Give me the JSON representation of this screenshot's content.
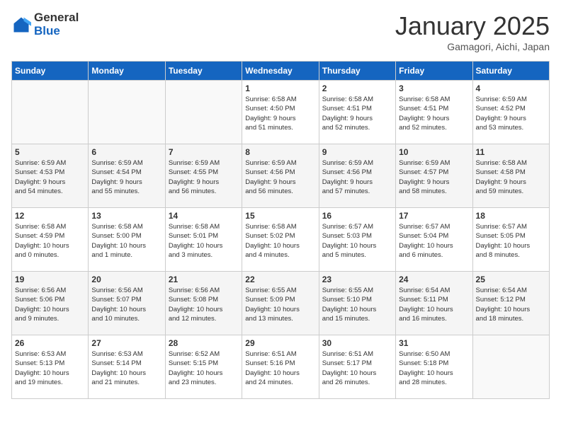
{
  "logo": {
    "general": "General",
    "blue": "Blue"
  },
  "title": "January 2025",
  "subtitle": "Gamagori, Aichi, Japan",
  "days_header": [
    "Sunday",
    "Monday",
    "Tuesday",
    "Wednesday",
    "Thursday",
    "Friday",
    "Saturday"
  ],
  "weeks": [
    [
      {
        "num": "",
        "info": ""
      },
      {
        "num": "",
        "info": ""
      },
      {
        "num": "",
        "info": ""
      },
      {
        "num": "1",
        "info": "Sunrise: 6:58 AM\nSunset: 4:50 PM\nDaylight: 9 hours\nand 51 minutes."
      },
      {
        "num": "2",
        "info": "Sunrise: 6:58 AM\nSunset: 4:51 PM\nDaylight: 9 hours\nand 52 minutes."
      },
      {
        "num": "3",
        "info": "Sunrise: 6:58 AM\nSunset: 4:51 PM\nDaylight: 9 hours\nand 52 minutes."
      },
      {
        "num": "4",
        "info": "Sunrise: 6:59 AM\nSunset: 4:52 PM\nDaylight: 9 hours\nand 53 minutes."
      }
    ],
    [
      {
        "num": "5",
        "info": "Sunrise: 6:59 AM\nSunset: 4:53 PM\nDaylight: 9 hours\nand 54 minutes."
      },
      {
        "num": "6",
        "info": "Sunrise: 6:59 AM\nSunset: 4:54 PM\nDaylight: 9 hours\nand 55 minutes."
      },
      {
        "num": "7",
        "info": "Sunrise: 6:59 AM\nSunset: 4:55 PM\nDaylight: 9 hours\nand 56 minutes."
      },
      {
        "num": "8",
        "info": "Sunrise: 6:59 AM\nSunset: 4:56 PM\nDaylight: 9 hours\nand 56 minutes."
      },
      {
        "num": "9",
        "info": "Sunrise: 6:59 AM\nSunset: 4:56 PM\nDaylight: 9 hours\nand 57 minutes."
      },
      {
        "num": "10",
        "info": "Sunrise: 6:59 AM\nSunset: 4:57 PM\nDaylight: 9 hours\nand 58 minutes."
      },
      {
        "num": "11",
        "info": "Sunrise: 6:58 AM\nSunset: 4:58 PM\nDaylight: 9 hours\nand 59 minutes."
      }
    ],
    [
      {
        "num": "12",
        "info": "Sunrise: 6:58 AM\nSunset: 4:59 PM\nDaylight: 10 hours\nand 0 minutes."
      },
      {
        "num": "13",
        "info": "Sunrise: 6:58 AM\nSunset: 5:00 PM\nDaylight: 10 hours\nand 1 minute."
      },
      {
        "num": "14",
        "info": "Sunrise: 6:58 AM\nSunset: 5:01 PM\nDaylight: 10 hours\nand 3 minutes."
      },
      {
        "num": "15",
        "info": "Sunrise: 6:58 AM\nSunset: 5:02 PM\nDaylight: 10 hours\nand 4 minutes."
      },
      {
        "num": "16",
        "info": "Sunrise: 6:57 AM\nSunset: 5:03 PM\nDaylight: 10 hours\nand 5 minutes."
      },
      {
        "num": "17",
        "info": "Sunrise: 6:57 AM\nSunset: 5:04 PM\nDaylight: 10 hours\nand 6 minutes."
      },
      {
        "num": "18",
        "info": "Sunrise: 6:57 AM\nSunset: 5:05 PM\nDaylight: 10 hours\nand 8 minutes."
      }
    ],
    [
      {
        "num": "19",
        "info": "Sunrise: 6:56 AM\nSunset: 5:06 PM\nDaylight: 10 hours\nand 9 minutes."
      },
      {
        "num": "20",
        "info": "Sunrise: 6:56 AM\nSunset: 5:07 PM\nDaylight: 10 hours\nand 10 minutes."
      },
      {
        "num": "21",
        "info": "Sunrise: 6:56 AM\nSunset: 5:08 PM\nDaylight: 10 hours\nand 12 minutes."
      },
      {
        "num": "22",
        "info": "Sunrise: 6:55 AM\nSunset: 5:09 PM\nDaylight: 10 hours\nand 13 minutes."
      },
      {
        "num": "23",
        "info": "Sunrise: 6:55 AM\nSunset: 5:10 PM\nDaylight: 10 hours\nand 15 minutes."
      },
      {
        "num": "24",
        "info": "Sunrise: 6:54 AM\nSunset: 5:11 PM\nDaylight: 10 hours\nand 16 minutes."
      },
      {
        "num": "25",
        "info": "Sunrise: 6:54 AM\nSunset: 5:12 PM\nDaylight: 10 hours\nand 18 minutes."
      }
    ],
    [
      {
        "num": "26",
        "info": "Sunrise: 6:53 AM\nSunset: 5:13 PM\nDaylight: 10 hours\nand 19 minutes."
      },
      {
        "num": "27",
        "info": "Sunrise: 6:53 AM\nSunset: 5:14 PM\nDaylight: 10 hours\nand 21 minutes."
      },
      {
        "num": "28",
        "info": "Sunrise: 6:52 AM\nSunset: 5:15 PM\nDaylight: 10 hours\nand 23 minutes."
      },
      {
        "num": "29",
        "info": "Sunrise: 6:51 AM\nSunset: 5:16 PM\nDaylight: 10 hours\nand 24 minutes."
      },
      {
        "num": "30",
        "info": "Sunrise: 6:51 AM\nSunset: 5:17 PM\nDaylight: 10 hours\nand 26 minutes."
      },
      {
        "num": "31",
        "info": "Sunrise: 6:50 AM\nSunset: 5:18 PM\nDaylight: 10 hours\nand 28 minutes."
      },
      {
        "num": "",
        "info": ""
      }
    ]
  ]
}
